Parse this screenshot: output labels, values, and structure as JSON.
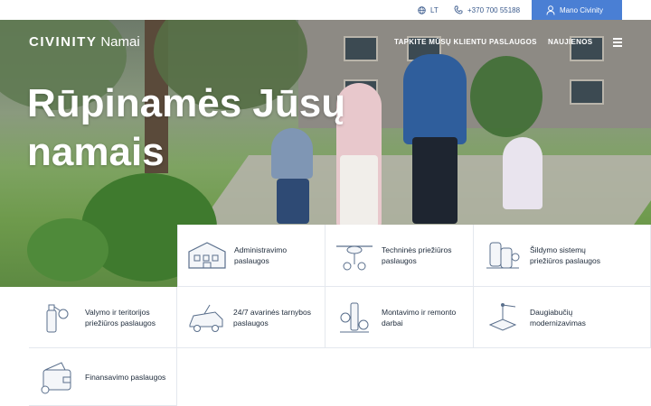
{
  "topbar": {
    "language": "LT",
    "phone": "+370 700 55188",
    "account": "Mano Civinity"
  },
  "header": {
    "brand": "CIVINITY",
    "brand_sub": "Namai",
    "nav": [
      "TAPKITE MŪSŲ KLIENTU",
      "PASLAUGOS",
      "NAUJIENOS"
    ]
  },
  "hero": {
    "headline": "Rūpinamės Jūsų namais"
  },
  "services": [
    {
      "label": "Administravimo paslaugos",
      "icon": "building-icon"
    },
    {
      "label": "Techninės priežiūros paslaugos",
      "icon": "drone-tools-icon"
    },
    {
      "label": "Šildymo sistemų priežiūros paslaugos",
      "icon": "heating-pipes-icon"
    },
    {
      "label": "Valymo ir teritorijos priežiūros paslaugos",
      "icon": "cleaning-spray-icon"
    },
    {
      "label": "24/7 avarinės tarnybos paslaugos",
      "icon": "emergency-car-icon"
    },
    {
      "label": "Montavimo ir remonto darbai",
      "icon": "repair-valve-icon"
    },
    {
      "label": "Daugiabučių modernizavimas",
      "icon": "crane-icon"
    },
    {
      "label": "Finansavimo paslaugos",
      "icon": "wallet-icon"
    }
  ],
  "colors": {
    "accent": "#4a7fd4",
    "text": "#1d2a3a",
    "link": "#3a5a8c"
  }
}
